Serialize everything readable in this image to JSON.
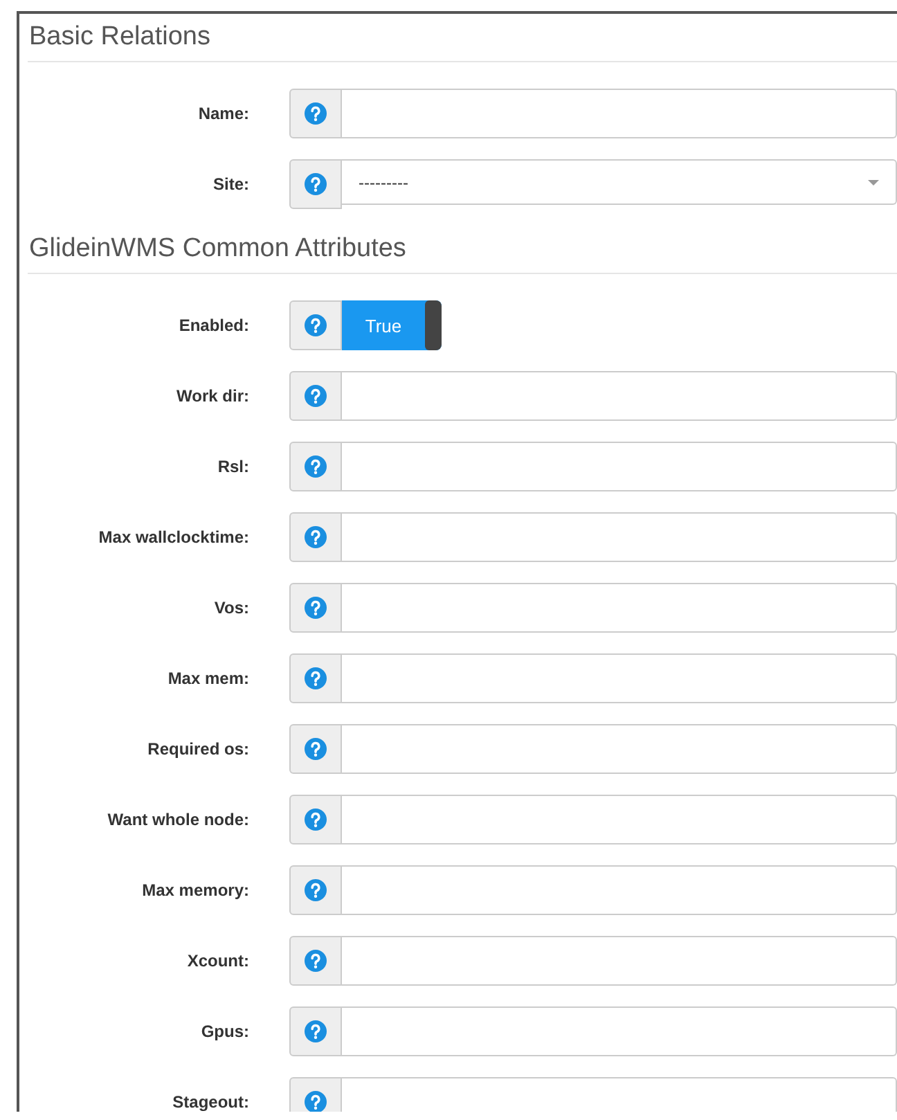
{
  "sections": [
    {
      "title": "Basic Relations",
      "fields": [
        {
          "label": "Name:",
          "kind": "text"
        },
        {
          "label": "Site:",
          "kind": "select",
          "value": "---------"
        }
      ]
    },
    {
      "title": "GlideinWMS Common Attributes",
      "fields": [
        {
          "label": "Enabled:",
          "kind": "toggle",
          "on": true,
          "value": "True"
        },
        {
          "label": "Work dir:",
          "kind": "text"
        },
        {
          "label": "Rsl:",
          "kind": "text"
        },
        {
          "label": "Max wallclocktime:",
          "kind": "text"
        },
        {
          "label": "Vos:",
          "kind": "text"
        },
        {
          "label": "Max mem:",
          "kind": "text"
        },
        {
          "label": "Required os:",
          "kind": "text"
        },
        {
          "label": "Want whole node:",
          "kind": "text"
        },
        {
          "label": "Max memory:",
          "kind": "text"
        },
        {
          "label": "Xcount:",
          "kind": "text"
        },
        {
          "label": "Gpus:",
          "kind": "text"
        },
        {
          "label": "Stageout:",
          "kind": "text"
        }
      ]
    }
  ]
}
